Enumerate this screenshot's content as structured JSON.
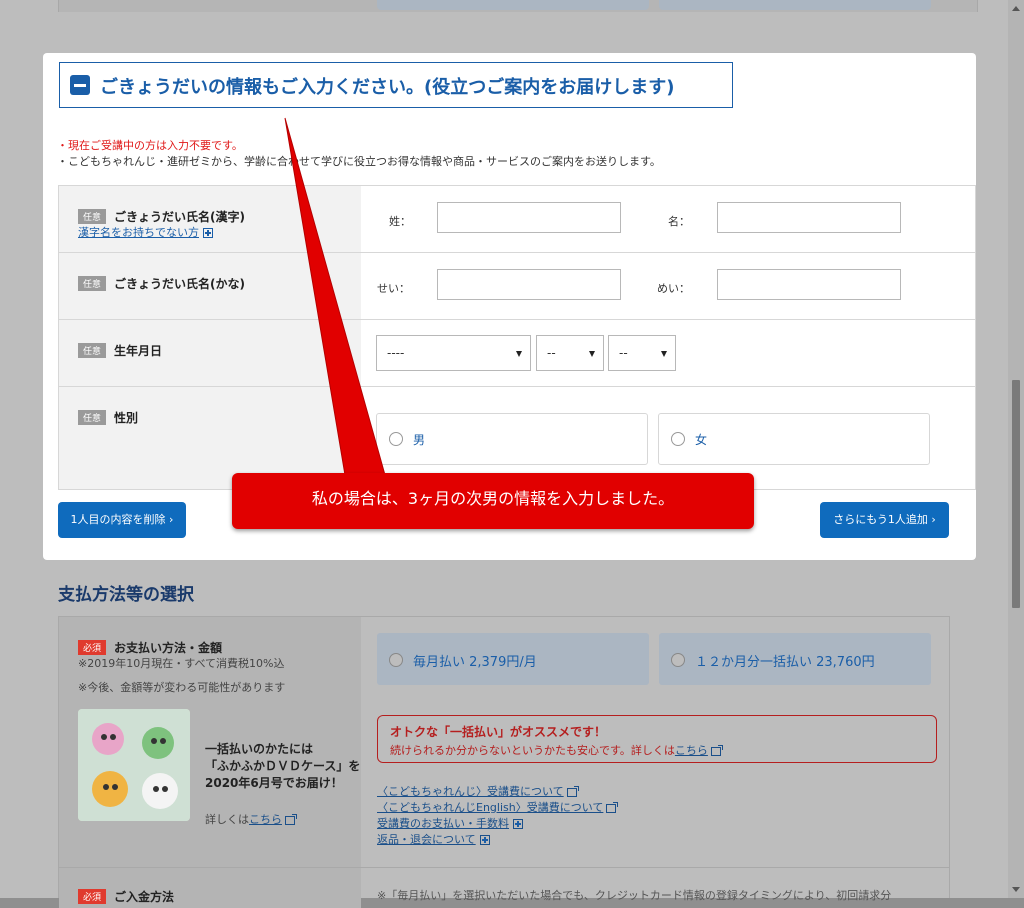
{
  "form_section": {
    "title": "ごきょうだいの情報もご入力ください。(役立つご案内をお届けします)",
    "note_red": "・現在ご受講中の方は入力不要です。",
    "note": "・こどもちゃれんじ・進研ゼミから、学齢に合わせて学びに役立つお得な情報や商品・サービスのご案内をお送りします。",
    "optional_tag": "任意",
    "rows": {
      "kanji_name": {
        "label": "ごきょうだい氏名(漢字)",
        "link": "漢字名をお持ちでない方",
        "last_label": "姓：",
        "first_label": "名："
      },
      "kana_name": {
        "label": "ごきょうだい氏名(かな)",
        "last_label": "せい：",
        "first_label": "めい："
      },
      "birthdate": {
        "label": "生年月日",
        "year": "----",
        "month": "--",
        "day": "--"
      },
      "gender": {
        "label": "性別",
        "male": "男",
        "female": "女"
      }
    },
    "delete_button": "1人目の内容を削除",
    "add_button": "さらにもう1人追加"
  },
  "callout": "私の場合は、3ヶ月の次男の情報を入力しました。",
  "payment": {
    "section_title": "支払方法等の選択",
    "required_tag": "必須",
    "row_label": "お支払い方法・金額",
    "tax_note": "※2019年10月現在・すべて消費税10%込",
    "change_note": "※今後、金額等が変わる可能性があります",
    "monthly": "毎月払い 2,379円/月",
    "lump": "１２か月分一括払い 23,760円",
    "promo_title": "オトクな「一括払い」がオススメです！",
    "promo_text": "続けられるか分からないというかたも安心です。詳しくは",
    "promo_link": "こちら",
    "dvd_text": [
      "一括払いのかたには",
      "「ふかふかＤＶＤケース」を",
      "2020年6月号でお届け！"
    ],
    "dvd_more": "詳しくは",
    "dvd_link": "こちら",
    "links": [
      "〈こどもちゃれんじ〉受講費について",
      "〈こどもちゃれんじEnglish〉受講費について",
      "受講費のお支払い・手数料",
      "返品・退会について"
    ],
    "row2_label": "ご入金方法",
    "row2_note": "※「毎月払い」を選択いただいた場合でも、クレジットカード情報の登録タイミングにより、初回請求分"
  }
}
